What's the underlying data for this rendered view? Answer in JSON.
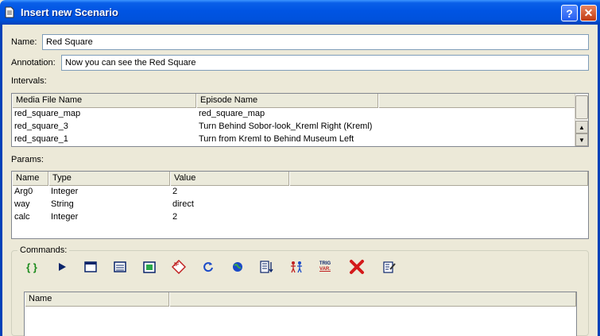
{
  "window": {
    "title": "Insert new Scenario",
    "help_glyph": "?",
    "close_glyph": "✕"
  },
  "form": {
    "name_label": "Name:",
    "name_value": "Red  Square",
    "annotation_label": "Annotation:",
    "annotation_value": "Now you can see the Red  Square"
  },
  "intervals": {
    "label": "Intervals:",
    "columns": [
      "Media File Name",
      "Episode Name"
    ],
    "rows": [
      [
        "red_square_map",
        "red_square_map"
      ],
      [
        "red_square_3",
        "Turn Behind Sobor-look_Kreml Right (Kreml)"
      ],
      [
        "red_square_1",
        "Turn from Kreml to Behind Museum Left"
      ]
    ]
  },
  "params": {
    "label": "Params:",
    "columns": [
      "Name",
      "Type",
      "Value"
    ],
    "rows": [
      [
        "Arg0",
        "Integer",
        "2"
      ],
      [
        "way",
        "String",
        "direct"
      ],
      [
        "calc",
        "Integer",
        "2"
      ]
    ]
  },
  "commands": {
    "label": "Commands:",
    "toolbar": [
      {
        "name": "braces-icon",
        "glyph": "{ }"
      },
      {
        "name": "play-icon"
      },
      {
        "name": "window-icon"
      },
      {
        "name": "list-window-icon"
      },
      {
        "name": "picture-icon"
      },
      {
        "name": "if-condition-icon",
        "glyph": "IF"
      },
      {
        "name": "loop-icon"
      },
      {
        "name": "globe-icon"
      },
      {
        "name": "sort-list-icon"
      },
      {
        "name": "people-icon"
      },
      {
        "name": "trig-variable-icon",
        "glyph_top": "TRIG",
        "glyph_bottom": "VAR."
      },
      {
        "name": "delete-icon"
      },
      {
        "name": "edit-icon"
      }
    ],
    "list_columns": [
      "Name"
    ]
  },
  "colors": {
    "title_bar": "#0054e3",
    "dialog_bg": "#ece9d8",
    "delete_red": "#d41a1a",
    "braces_green": "#1a8a1a",
    "play_blue": "#0a246a"
  }
}
